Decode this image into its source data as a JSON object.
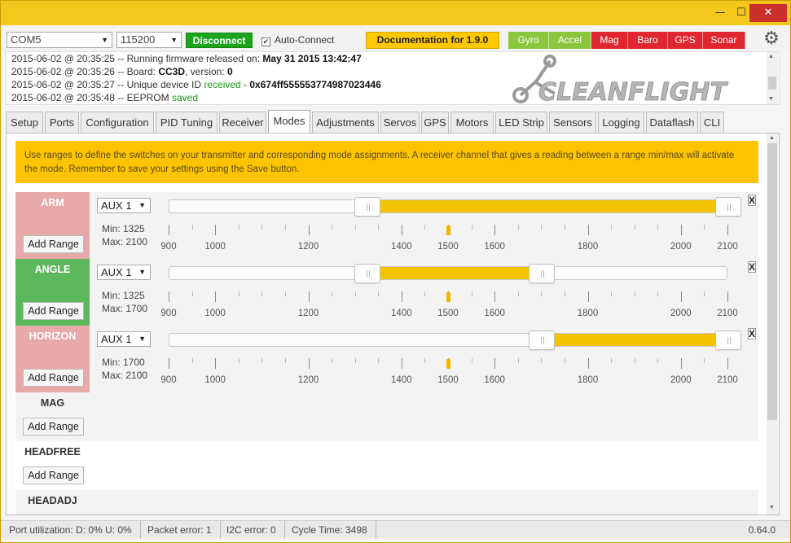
{
  "window": {
    "controls": {
      "minimize": "—",
      "maximize": "☐",
      "close": "✕"
    }
  },
  "topbar": {
    "port": "COM5",
    "baud": "115200",
    "disconnect_label": "Disconnect",
    "auto_connect_label": "Auto-Connect",
    "auto_connect_checked": true,
    "documentation_label": "Documentation for 1.9.0",
    "sensors": [
      {
        "label": "Gyro",
        "color": "#8cc63f"
      },
      {
        "label": "Accel",
        "color": "#8cc63f"
      },
      {
        "label": "Mag",
        "color": "#e0262e"
      },
      {
        "label": "Baro",
        "color": "#e0262e"
      },
      {
        "label": "GPS",
        "color": "#e0262e"
      },
      {
        "label": "Sonar",
        "color": "#e0262e"
      }
    ]
  },
  "log": [
    {
      "ts": "2015-06-02 @ 20:35:25",
      "text": " -- Running firmware released on: ",
      "bold": "May 31 2015 13:42:47",
      "green": ""
    },
    {
      "ts": "2015-06-02 @ 20:35:26",
      "text": " -- Board: ",
      "bold": "CC3D",
      "after": ", version: ",
      "bold2": "0"
    },
    {
      "ts": "2015-06-02 @ 20:35:27",
      "text": " -- Unique device ID ",
      "green": "received",
      "after": " - ",
      "bold": "0x674ff555553774987023446"
    },
    {
      "ts": "2015-06-02 @ 20:35:48",
      "text": " -- EEPROM ",
      "green": "saved"
    }
  ],
  "logo_text": "CLEANFLIGHT",
  "tabs": [
    "Setup",
    "Ports",
    "Configuration",
    "PID Tuning",
    "Receiver",
    "Modes",
    "Adjustments",
    "Servos",
    "GPS",
    "Motors",
    "LED Strip",
    "Sensors",
    "Logging",
    "Dataflash",
    "CLI"
  ],
  "active_tab": "Modes",
  "note": "Use ranges to define the switches on your transmitter and corresponding mode assignments. A receiver channel that gives a reading between a range min/max will activate the mode. Remember to save your settings using the Save button.",
  "add_range_label": "Add Range",
  "remove_label": "X",
  "scale_labels": [
    "900",
    "1000",
    "1200",
    "1400",
    "1500",
    "1600",
    "1800",
    "2000",
    "2100"
  ],
  "modes": [
    {
      "name": "ARM",
      "color": "#e8a9a9",
      "name_color": "#ffffff",
      "has_range": true,
      "channel": "AUX 1",
      "min_label": "Min: 1325",
      "max_label": "Max: 2100",
      "min": 1325,
      "max": 2100,
      "current": 1500
    },
    {
      "name": "ANGLE",
      "color": "#5cb85c",
      "name_color": "#ffffff",
      "has_range": true,
      "channel": "AUX 1",
      "min_label": "Min: 1325",
      "max_label": "Max: 1700",
      "min": 1325,
      "max": 1700,
      "current": 1500
    },
    {
      "name": "HORIZON",
      "color": "#e8a9a9",
      "name_color": "#ffffff",
      "has_range": true,
      "channel": "AUX 1",
      "min_label": "Min: 1700",
      "max_label": "Max: 2100",
      "min": 1700,
      "max": 2100,
      "current": 1500
    },
    {
      "name": "MAG",
      "color": "#f3f3f3",
      "name_color": "#333333",
      "has_range": false
    },
    {
      "name": "HEADFREE",
      "color": "#ffffff",
      "name_color": "#333333",
      "has_range": false
    },
    {
      "name": "HEADADJ",
      "color": "#f3f3f3",
      "name_color": "#333333",
      "has_range": false
    }
  ],
  "statusbar": {
    "port_util": "Port utilization: D: 0% U: 0%",
    "packet_error": "Packet error: 1",
    "i2c_error": "I2C error: 0",
    "cycle_time": "Cycle Time: 3498",
    "version": "0.64.0"
  }
}
